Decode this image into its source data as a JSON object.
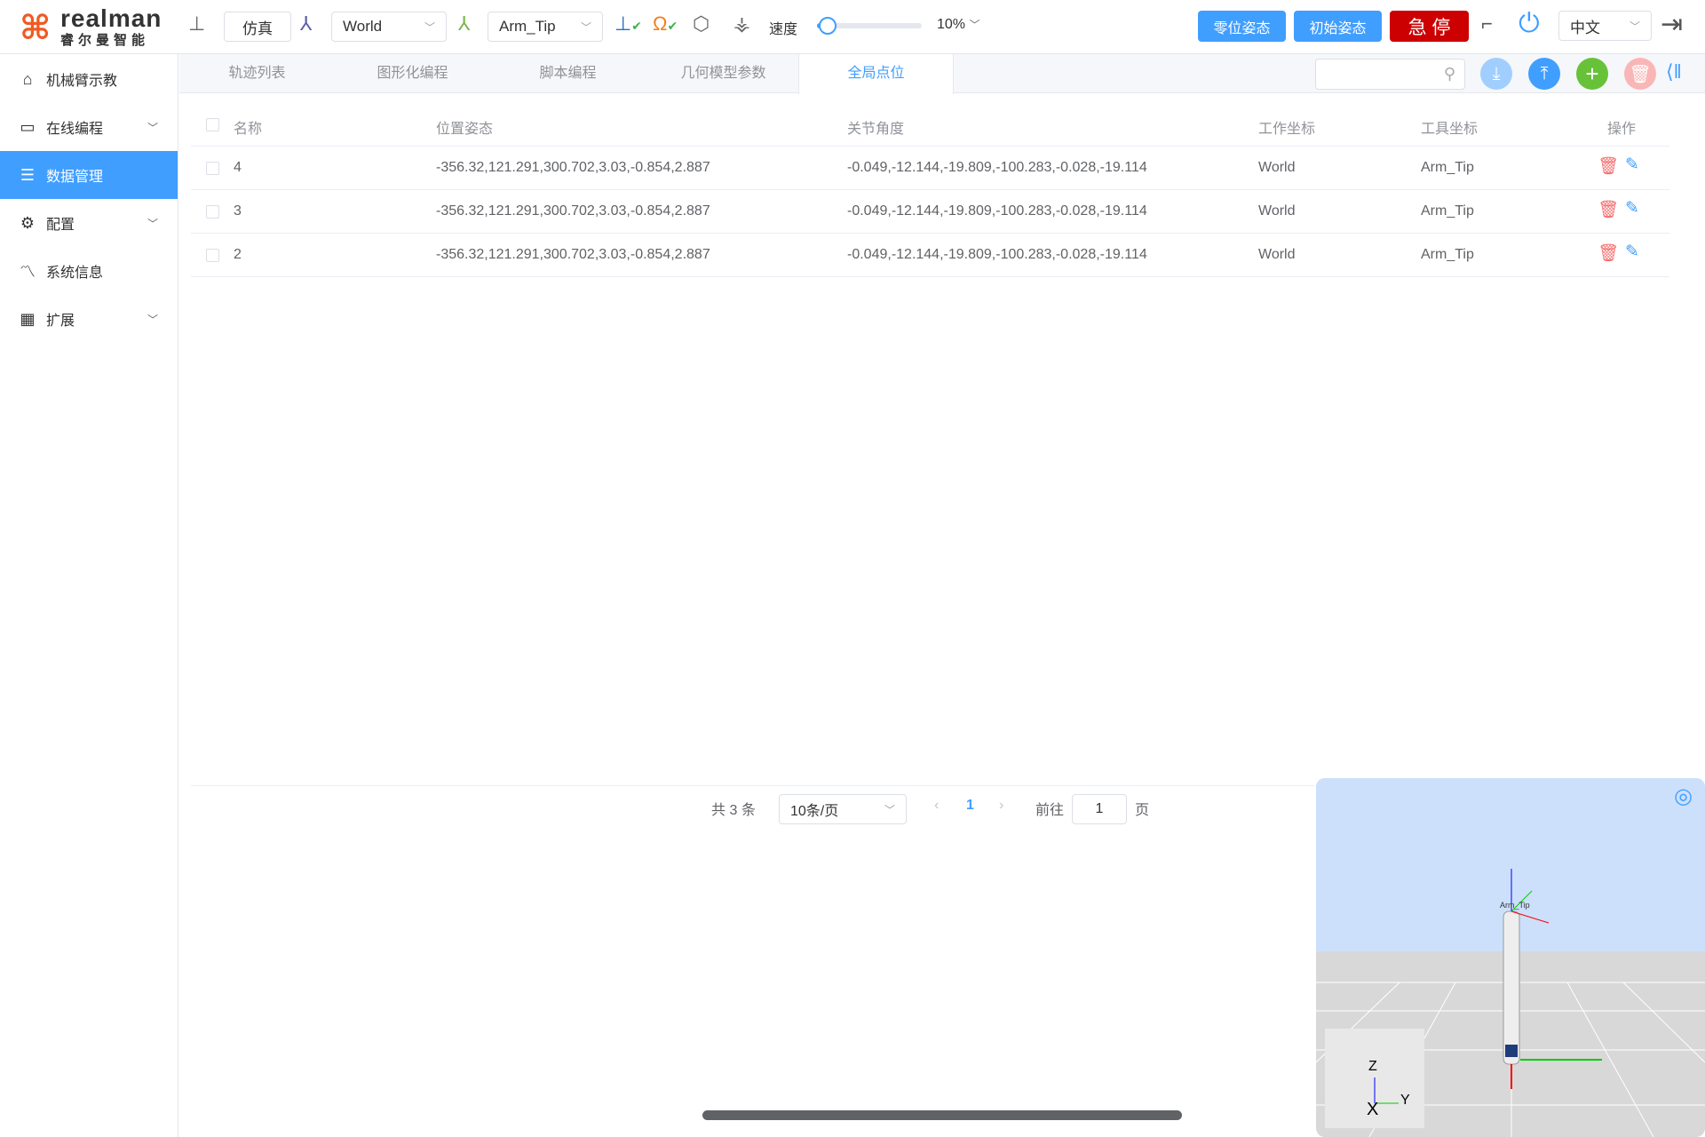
{
  "header": {
    "logo_en": "realman",
    "logo_cn": "睿尔曼智能",
    "sim_label": "仿真",
    "work_frame": "World",
    "tool_frame": "Arm_Tip",
    "speed_label": "速度",
    "speed_value": "10%",
    "speed_fraction": 0.1,
    "zero_pose": "零位姿态",
    "init_pose": "初始姿态",
    "estop": "急 停",
    "language": "中文"
  },
  "sidebar": {
    "items": [
      {
        "label": "机械臂示教",
        "icon": "home-icon"
      },
      {
        "label": "在线编程",
        "icon": "code-icon",
        "expandable": true
      },
      {
        "label": "数据管理",
        "icon": "database-icon",
        "active": true
      },
      {
        "label": "配置",
        "icon": "gear-icon",
        "expandable": true
      },
      {
        "label": "系统信息",
        "icon": "monitor-icon"
      },
      {
        "label": "扩展",
        "icon": "grid-icon",
        "expandable": true
      }
    ]
  },
  "tabs": [
    "轨迹列表",
    "图形化编程",
    "脚本编程",
    "几何模型参数",
    "全局点位"
  ],
  "search": {
    "placeholder": ""
  },
  "table": {
    "headers": [
      "名称",
      "位置姿态",
      "关节角度",
      "工作坐标",
      "工具坐标",
      "操作"
    ],
    "rows": [
      {
        "name": "4",
        "pose": "-356.32,121.291,300.702,3.03,-0.854,2.887",
        "joints": "-0.049,-12.144,-19.809,-100.283,-0.028,-19.114",
        "work": "World",
        "tool": "Arm_Tip"
      },
      {
        "name": "3",
        "pose": "-356.32,121.291,300.702,3.03,-0.854,2.887",
        "joints": "-0.049,-12.144,-19.809,-100.283,-0.028,-19.114",
        "work": "World",
        "tool": "Arm_Tip"
      },
      {
        "name": "2",
        "pose": "-356.32,121.291,300.702,3.03,-0.854,2.887",
        "joints": "-0.049,-12.144,-19.809,-100.283,-0.028,-19.114",
        "work": "World",
        "tool": "Arm_Tip"
      }
    ]
  },
  "pagination": {
    "total_prefix": "共",
    "total": "3",
    "total_suffix": "条",
    "page_size": "10条/页",
    "current": "1",
    "goto_label": "前往",
    "goto_value": "1",
    "page_suffix": "页"
  },
  "viewer": {
    "tip_label": "Arm_Tip",
    "axes": {
      "x": "X",
      "y": "Y",
      "z": "Z"
    }
  },
  "colors": {
    "accent": "#409eff",
    "estop": "#cc0000",
    "add": "#67c23a",
    "delete": "#f56c6c"
  }
}
